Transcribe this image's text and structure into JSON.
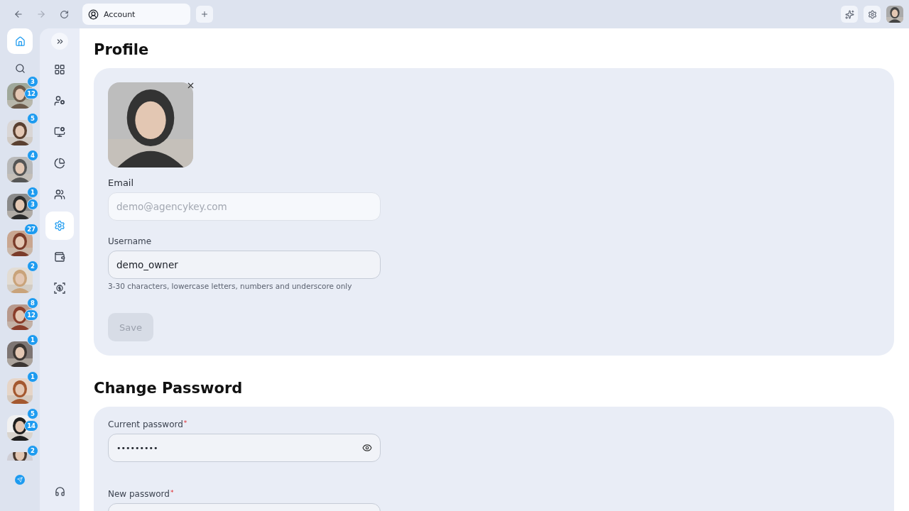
{
  "browser": {
    "tabs": [
      {
        "label": "Account",
        "selected": true
      }
    ]
  },
  "rail": {
    "items": [
      {
        "kind": "home",
        "selected": true
      },
      {
        "kind": "search",
        "selected": false
      }
    ]
  },
  "contacts": [
    {
      "badges": [
        "3",
        "12"
      ]
    },
    {
      "badges": [
        "5"
      ]
    },
    {
      "badges": [
        "4"
      ]
    },
    {
      "badges": [
        "1",
        "3"
      ]
    },
    {
      "badges": [
        "27"
      ]
    },
    {
      "badges": [
        "2"
      ]
    },
    {
      "badges": [
        "8",
        "12"
      ]
    },
    {
      "badges": [
        "1"
      ]
    },
    {
      "badges": [
        "1"
      ]
    },
    {
      "badges": [
        "5",
        "14"
      ]
    },
    {
      "badges": [
        "2"
      ],
      "cut": true
    }
  ],
  "nav": {
    "items": [
      {
        "kind": "grid",
        "selected": false
      },
      {
        "kind": "user-cog",
        "selected": false
      },
      {
        "kind": "monitor-cog",
        "selected": false
      },
      {
        "kind": "pie",
        "selected": false
      },
      {
        "kind": "users",
        "selected": false
      },
      {
        "kind": "settings",
        "selected": true
      },
      {
        "kind": "wallet",
        "selected": false
      },
      {
        "kind": "scan",
        "selected": false
      }
    ]
  },
  "profile": {
    "title": "Profile",
    "email": {
      "label": "Email",
      "placeholder": "demo@agencykey.com",
      "disabled": true
    },
    "username": {
      "label": "Username",
      "value": "demo_owner",
      "hint": "3-30 characters, lowercase letters, numbers and underscore only"
    },
    "save": {
      "label": "Save",
      "disabled": true
    }
  },
  "password": {
    "title": "Change Password",
    "fields": [
      {
        "label": "Current password",
        "required_mark": "*",
        "value": "•••••••••",
        "masked": true
      },
      {
        "label": "New password",
        "required_mark": "*"
      }
    ]
  }
}
